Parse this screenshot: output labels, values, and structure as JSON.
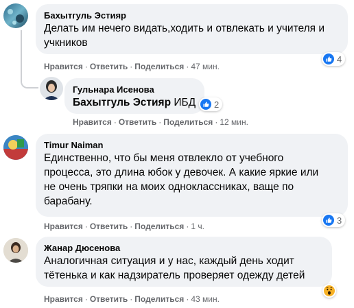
{
  "actions": {
    "like": "Нравится",
    "reply": "Ответить",
    "share": "Поделиться",
    "sep": "·"
  },
  "comments": [
    {
      "author": "Бахытгуль Эстияр",
      "text": "Делать им нечего видать,ходить и отвлекать и учителя и учкников",
      "time": "47 мин.",
      "reaction": {
        "icon": "like-icon",
        "count": "4"
      }
    },
    {
      "author": "Гульнара Исенова",
      "mention": "Бахытгуль Эстияр",
      "text": " ИБД",
      "time": "12 мин.",
      "reaction": {
        "icon": "like-icon",
        "count": "2"
      }
    },
    {
      "author": "Timur Naiman",
      "text": "Единственно, что бы меня отвлекло от учебного процесса, это длина юбок у девочек. А какие яркие или не очень тряпки на моих одноклассниках, ваще по барабану.",
      "time": "1 ч.",
      "reaction": {
        "icon": "like-icon",
        "count": "3"
      }
    },
    {
      "author": "Жанар Дюсенова",
      "text": "Аналогичная ситуация и у нас, каждый день ходит тётенька и как надзиратель проверяет одежду детей",
      "time": "43 мин.",
      "reaction": {
        "icon": "wow-icon",
        "count": ""
      }
    }
  ],
  "colors": {
    "like_blue": "#1877f2",
    "wow_yellow": "#f7b125",
    "bubble": "#f0f2f5",
    "meta": "#65676b"
  }
}
